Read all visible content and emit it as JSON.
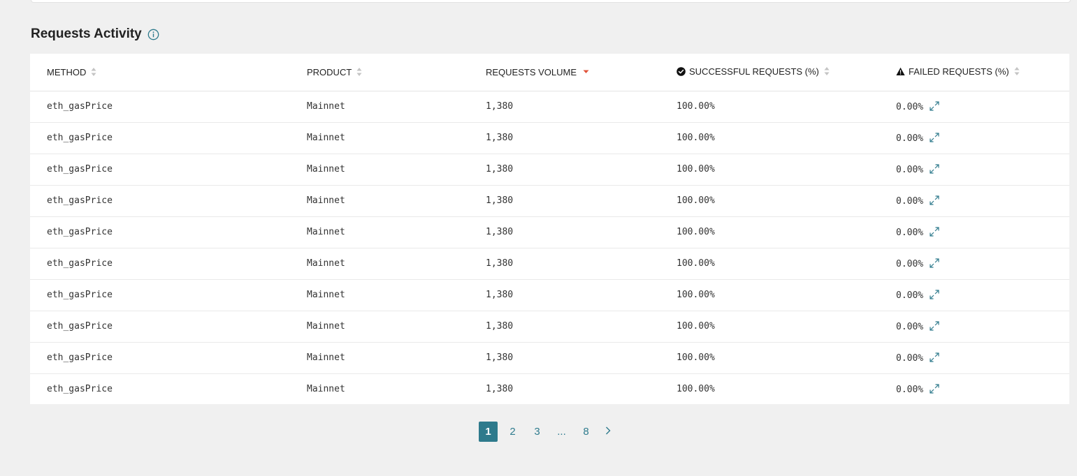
{
  "section": {
    "title": "Requests Activity"
  },
  "table": {
    "columns": [
      {
        "label": "METHOD"
      },
      {
        "label": "PRODUCT"
      },
      {
        "label": "REQUESTS VOLUME"
      },
      {
        "label": "SUCCESSFUL REQUESTS (%)"
      },
      {
        "label": "FAILED REQUESTS (%)"
      }
    ],
    "sorted_column": "REQUESTS VOLUME",
    "rows": [
      {
        "method": "eth_gasPrice",
        "product": "Mainnet",
        "volume": "1,380",
        "success": "100.00%",
        "failed": "0.00%"
      },
      {
        "method": "eth_gasPrice",
        "product": "Mainnet",
        "volume": "1,380",
        "success": "100.00%",
        "failed": "0.00%"
      },
      {
        "method": "eth_gasPrice",
        "product": "Mainnet",
        "volume": "1,380",
        "success": "100.00%",
        "failed": "0.00%"
      },
      {
        "method": "eth_gasPrice",
        "product": "Mainnet",
        "volume": "1,380",
        "success": "100.00%",
        "failed": "0.00%"
      },
      {
        "method": "eth_gasPrice",
        "product": "Mainnet",
        "volume": "1,380",
        "success": "100.00%",
        "failed": "0.00%"
      },
      {
        "method": "eth_gasPrice",
        "product": "Mainnet",
        "volume": "1,380",
        "success": "100.00%",
        "failed": "0.00%"
      },
      {
        "method": "eth_gasPrice",
        "product": "Mainnet",
        "volume": "1,380",
        "success": "100.00%",
        "failed": "0.00%"
      },
      {
        "method": "eth_gasPrice",
        "product": "Mainnet",
        "volume": "1,380",
        "success": "100.00%",
        "failed": "0.00%"
      },
      {
        "method": "eth_gasPrice",
        "product": "Mainnet",
        "volume": "1,380",
        "success": "100.00%",
        "failed": "0.00%"
      },
      {
        "method": "eth_gasPrice",
        "product": "Mainnet",
        "volume": "1,380",
        "success": "100.00%",
        "failed": "0.00%"
      }
    ]
  },
  "pagination": {
    "pages": [
      "1",
      "2",
      "3"
    ],
    "ellipsis": "...",
    "last_page": "8",
    "current": "1"
  },
  "colors": {
    "accent": "#2e7a8c",
    "sort_active": "#e0533a",
    "sort_inactive": "#c4c4c4",
    "background": "#f0f0f0"
  },
  "icons": {
    "info": "info-icon",
    "sort": "sort-icon",
    "sort_active": "sort-desc-icon",
    "success": "check-circle-icon",
    "failed": "warning-triangle-icon",
    "row_link": "expand-link-icon",
    "next": "chevron-right-icon"
  }
}
